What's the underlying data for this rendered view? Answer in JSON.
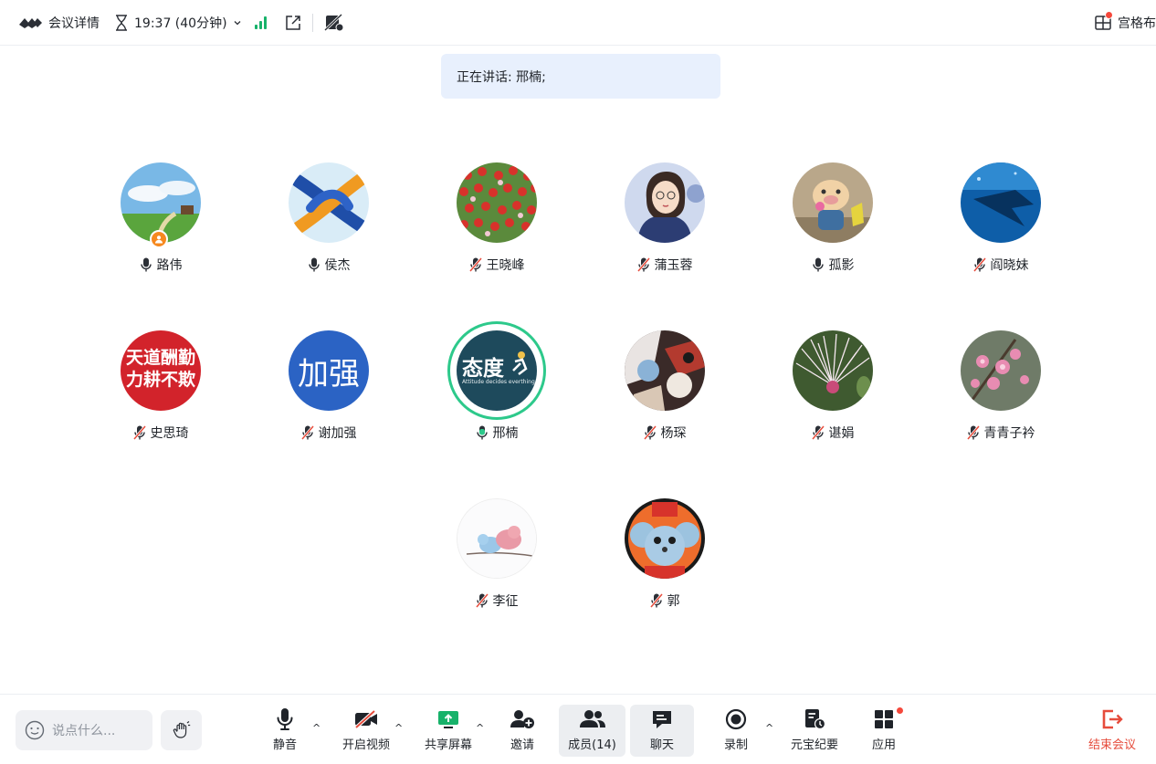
{
  "topbar": {
    "meeting_details": "会议详情",
    "timer": "19:37 (40分钟)",
    "layout_label": "宫格布"
  },
  "speaking_banner": "正在讲话: 邢楠;",
  "participants": [
    {
      "name": "路伟",
      "mic": "on",
      "avatar": "landscape",
      "host": true
    },
    {
      "name": "侯杰",
      "mic": "on",
      "avatar": "knot"
    },
    {
      "name": "王晓峰",
      "mic": "muted",
      "avatar": "tulips"
    },
    {
      "name": "蒲玉蓉",
      "mic": "muted",
      "avatar": "woman-glasses"
    },
    {
      "name": "孤影",
      "mic": "on",
      "avatar": "pig-toy"
    },
    {
      "name": "阎晓妹",
      "mic": "muted",
      "avatar": "manta-ray"
    },
    {
      "name": "史思琦",
      "mic": "muted",
      "avatar": "calligraphy",
      "avatar_text": [
        "天道酬勤",
        "力耕不欺"
      ]
    },
    {
      "name": "谢加强",
      "mic": "muted",
      "avatar": "text-avatar",
      "avatar_text": [
        "加强"
      ]
    },
    {
      "name": "邢楠",
      "mic": "speaking",
      "avatar": "attitude",
      "avatar_text": [
        "态度",
        "Attitude decides everthing"
      ]
    },
    {
      "name": "杨琛",
      "mic": "muted",
      "avatar": "painting"
    },
    {
      "name": "谌娟",
      "mic": "muted",
      "avatar": "flower-burst"
    },
    {
      "name": "青青子衿",
      "mic": "muted",
      "avatar": "pink-blossom"
    },
    {
      "name": "李征",
      "mic": "muted",
      "avatar": "birds"
    },
    {
      "name": "郭",
      "mic": "muted",
      "avatar": "cartoon-mouse"
    }
  ],
  "toolbar": {
    "chat_placeholder": "说点什么...",
    "mute": "静音",
    "start_video": "开启视频",
    "share_screen": "共享屏幕",
    "invite": "邀请",
    "members": "成员(14)",
    "chat": "聊天",
    "record": "录制",
    "yuanbao": "元宝纪要",
    "apps": "应用",
    "end_meeting": "结束会议"
  },
  "colors": {
    "speaking_ring": "#2dc98b",
    "muted_slash": "#e64c3c",
    "end_meeting": "#e64c3c",
    "banner_bg": "#e8f0fd",
    "signal": "#17b26a"
  }
}
